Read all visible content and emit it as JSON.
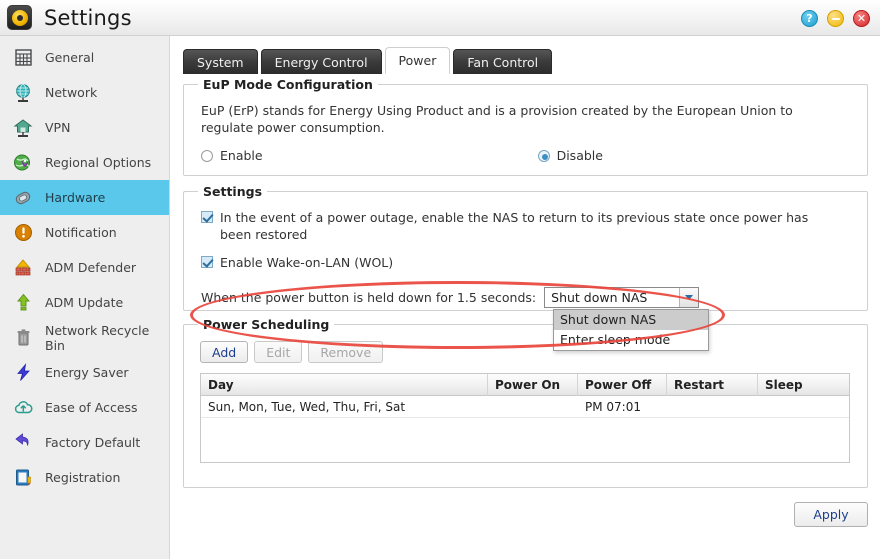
{
  "window": {
    "title": "Settings",
    "app_icon": "settings-gear-icon",
    "controls": [
      {
        "name": "help-button",
        "glyph": "?"
      },
      {
        "name": "minimize-button",
        "glyph": "–"
      },
      {
        "name": "close-button",
        "glyph": "✕"
      }
    ]
  },
  "sidebar": {
    "items": [
      {
        "label": "General",
        "icon": "building-icon",
        "active": false
      },
      {
        "label": "Network",
        "icon": "globe-network-icon",
        "active": false
      },
      {
        "label": "VPN",
        "icon": "house-network-icon",
        "active": false
      },
      {
        "label": "Regional Options",
        "icon": "globe-pin-icon",
        "active": false
      },
      {
        "label": "Hardware",
        "icon": "hardware-chip-icon",
        "active": true
      },
      {
        "label": "Notification",
        "icon": "alert-circle-icon",
        "active": false
      },
      {
        "label": "ADM Defender",
        "icon": "firewall-icon",
        "active": false
      },
      {
        "label": "ADM Update",
        "icon": "up-arrow-icon",
        "active": false
      },
      {
        "label": "Network Recycle Bin",
        "icon": "trash-icon",
        "active": false
      },
      {
        "label": "Energy Saver",
        "icon": "lightning-bolt-icon",
        "active": false
      },
      {
        "label": "Ease of Access",
        "icon": "cloud-upload-icon",
        "active": false
      },
      {
        "label": "Factory Default",
        "icon": "undo-arrow-icon",
        "active": false
      },
      {
        "label": "Registration",
        "icon": "clipboard-icon",
        "active": false
      }
    ]
  },
  "tabs": [
    {
      "label": "System",
      "active": false
    },
    {
      "label": "Energy Control",
      "active": false
    },
    {
      "label": "Power",
      "active": true
    },
    {
      "label": "Fan Control",
      "active": false
    }
  ],
  "eup": {
    "legend": "EuP Mode Configuration",
    "description": "EuP (ErP) stands for Energy Using Product and is a provision created by the European Union to regulate power consumption.",
    "options": [
      {
        "label": "Enable",
        "selected": false
      },
      {
        "label": "Disable",
        "selected": true
      }
    ]
  },
  "settings": {
    "legend": "Settings",
    "checkboxes": [
      {
        "label": "In the event of a power outage, enable the NAS to return to its previous state once power has been restored",
        "checked": true
      },
      {
        "label": "Enable Wake-on-LAN (WOL)",
        "checked": true
      }
    ],
    "power_button": {
      "label": "When the power button is held down for 1.5 seconds:",
      "selected_value": "Shut down NAS",
      "options": [
        "Shut down NAS",
        "Enter sleep mode"
      ],
      "open": true,
      "highlighted_option": "Shut down NAS"
    }
  },
  "scheduling": {
    "legend": "Power Scheduling",
    "buttons": [
      {
        "label": "Add",
        "enabled": true
      },
      {
        "label": "Edit",
        "enabled": false
      },
      {
        "label": "Remove",
        "enabled": false
      }
    ],
    "columns": [
      "Day",
      "Power On",
      "Power Off",
      "Restart",
      "Sleep"
    ],
    "rows": [
      {
        "day": "Sun, Mon, Tue, Wed, Thu, Fri, Sat",
        "power_on": "",
        "power_off": "PM 07:01",
        "restart": "",
        "sleep": ""
      }
    ]
  },
  "footer": {
    "apply_label": "Apply"
  },
  "colors": {
    "sidebar_active": "#5ac8ea",
    "annotation": "#e8453c",
    "button_text": "#1b3e8c",
    "checkbox_fill": "#d6ebf7"
  }
}
